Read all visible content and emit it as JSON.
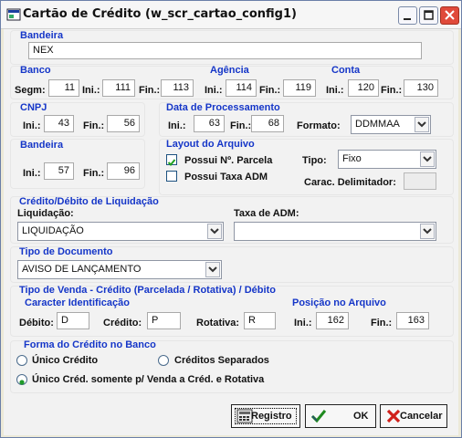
{
  "window": {
    "title": "Cartão de Crédito (w_scr_cartao_config1)"
  },
  "bandeira_top": {
    "header": "Bandeira",
    "value": "NEX"
  },
  "banco": {
    "header": "Banco",
    "segm_label": "Segm:",
    "segm": "11",
    "ini_label": "Ini.:",
    "ini": "111",
    "fin_label": "Fin.:",
    "fin": "113"
  },
  "agencia": {
    "header": "Agência",
    "ini_label": "Ini.:",
    "ini": "114",
    "fin_label": "Fin.:",
    "fin": "119"
  },
  "conta": {
    "header": "Conta",
    "ini_label": "Ini.:",
    "ini": "120",
    "fin_label": "Fin.:",
    "fin": "130"
  },
  "cnpj": {
    "header": "CNPJ",
    "ini_label": "Ini.:",
    "ini": "43",
    "fin_label": "Fin.:",
    "fin": "56"
  },
  "data_processamento": {
    "header": "Data de Processamento",
    "ini_label": "Ini.:",
    "ini": "63",
    "fin_label": "Fin.:",
    "fin": "68",
    "formato_label": "Formato:",
    "formato": "DDMMAA"
  },
  "bandeira_pos": {
    "header": "Bandeira",
    "ini_label": "Ini.:",
    "ini": "57",
    "fin_label": "Fin.:",
    "fin": "96"
  },
  "layout": {
    "header": "Layout do Arquivo",
    "possui_parcela_label": "Possui Nº. Parcela",
    "possui_parcela_checked": true,
    "possui_taxa_label": "Possui Taxa ADM",
    "possui_taxa_checked": false,
    "tipo_label": "Tipo:",
    "tipo": "Fixo",
    "delimitador_label": "Carac. Delimitador:",
    "delimitador": ""
  },
  "liquidacao": {
    "header": "Crédito/Débito de Liquidação",
    "liquidacao_label": "Liquidação:",
    "liquidacao": "LIQUIDAÇÃO",
    "taxa_label": "Taxa de ADM:",
    "taxa": ""
  },
  "tipo_documento": {
    "header": "Tipo de Documento",
    "value": "AVISO DE LANÇAMENTO"
  },
  "tipo_venda": {
    "header": "Tipo de Venda - Crédito (Parcelada / Rotativa) / Débito",
    "identificacao_header": "Caracter Identificação",
    "debito_label": "Débito:",
    "debito": "D",
    "credito_label": "Crédito:",
    "credito": "P",
    "rotativa_label": "Rotativa:",
    "rotativa": "R",
    "posicao_header": "Posição no Arquivo",
    "ini_label": "Ini.:",
    "ini": "162",
    "fin_label": "Fin.:",
    "fin": "163"
  },
  "forma_credito": {
    "header": "Forma do Crédito no Banco",
    "options": [
      "Único Crédito",
      "Créditos Separados",
      "Único Créd. somente p/ Venda a Créd. e Rotativa"
    ],
    "selected_index": 2
  },
  "buttons": {
    "registro": "Registro",
    "ok": "OK",
    "cancelar": "Cancelar"
  },
  "colors": {
    "header_blue": "#1536c8",
    "close_red": "#e04a3a"
  }
}
